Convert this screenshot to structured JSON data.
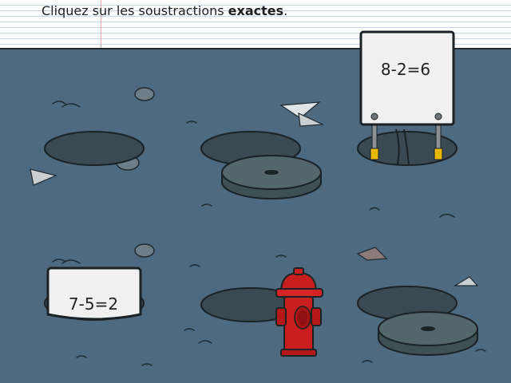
{
  "instruction": {
    "prefix": "Cliquez sur les soustractions ",
    "emphasis": "exactes",
    "suffix": "."
  },
  "manholes": [
    {
      "id": "hole-top-left",
      "state": "closed-empty"
    },
    {
      "id": "hole-top-center",
      "state": "cover-removed"
    },
    {
      "id": "hole-top-right",
      "state": "open-with-sign",
      "equation": "8-2=6"
    },
    {
      "id": "hole-bottom-left",
      "state": "open-with-sign",
      "equation": "7-5=2"
    },
    {
      "id": "hole-bottom-center",
      "state": "closed-with-hydrant"
    },
    {
      "id": "hole-bottom-right",
      "state": "cover-removed"
    }
  ],
  "colors": {
    "ground": "#4e6a80",
    "hole": "#3b4a52",
    "cover": "#52666c",
    "panel": "#f0f0f0",
    "hydrant": "#c81e1e"
  }
}
